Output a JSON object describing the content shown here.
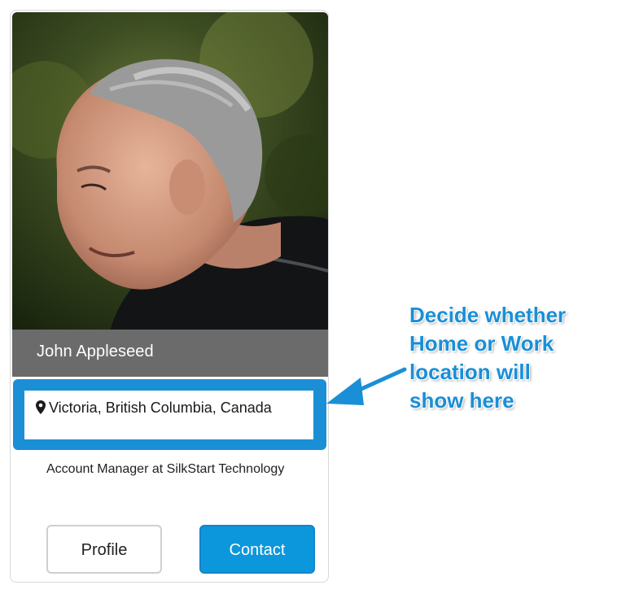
{
  "profile": {
    "name": "John Appleseed",
    "location": "Victoria, British Columbia, Canada",
    "job_title": "Account Manager at SilkStart Technology",
    "location_icon": "map-pin-icon"
  },
  "actions": {
    "profile_label": "Profile",
    "contact_label": "Contact"
  },
  "annotation": {
    "lines": [
      "Decide whether",
      "Home or Work",
      "location will",
      "show here"
    ]
  },
  "colors": {
    "accent": "#0c97dc",
    "highlight": "#1a8fd6",
    "name_bar": "#6b6b6b"
  }
}
